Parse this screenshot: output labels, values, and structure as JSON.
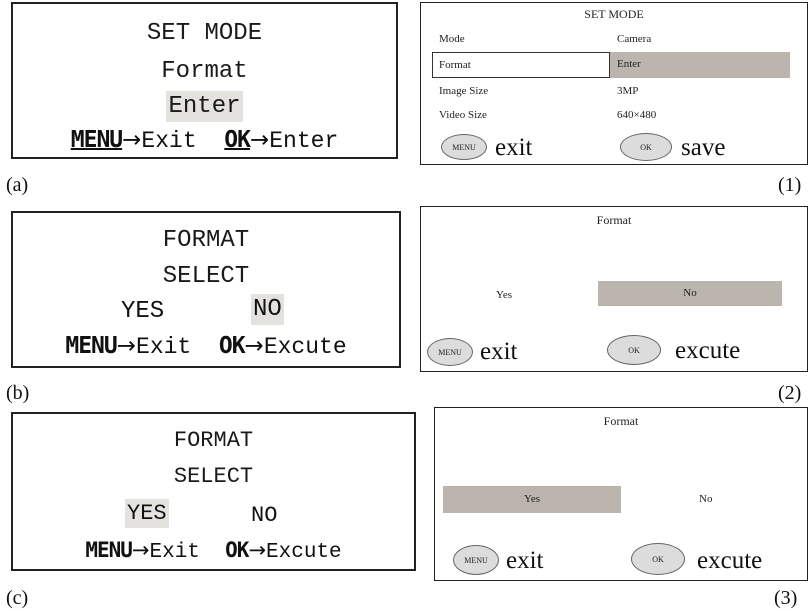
{
  "a": {
    "title": "SET MODE",
    "item": "Format",
    "selected": "Enter",
    "menu_key": "MENU",
    "menu_action": "Exit",
    "ok_key": "OK",
    "ok_action": "Enter",
    "arrow": "→",
    "label": "(a)"
  },
  "one": {
    "title": "SET MODE",
    "rows": [
      {
        "name": "Mode",
        "value": "Camera"
      },
      {
        "name": "Format",
        "value": "Enter"
      },
      {
        "name": "Image Size",
        "value": "3MP"
      },
      {
        "name": "Video Size",
        "value": "640×480"
      }
    ],
    "menu_icon": "MENU",
    "menu_text": "exit",
    "ok_icon": "OK",
    "ok_text": "save",
    "label": "(1)"
  },
  "b": {
    "title": "FORMAT",
    "subtitle": "SELECT",
    "yes": "YES",
    "no": "NO",
    "menu_key": "MENU",
    "menu_action": "Exit",
    "ok_key": "OK",
    "ok_action": "Excute",
    "arrow": "→",
    "label": "(b)"
  },
  "two": {
    "title": "Format",
    "yes": "Yes",
    "no": "No",
    "menu_icon": "MENU",
    "menu_text": "exit",
    "ok_icon": "OK",
    "ok_text": "excute",
    "label": "(2)"
  },
  "c": {
    "title": "FORMAT",
    "subtitle": "SELECT",
    "yes": "YES",
    "no": "NO",
    "menu_key": "MENU",
    "menu_action": "Exit",
    "ok_key": "OK",
    "ok_action": "Excute",
    "arrow": "→",
    "label": "(c)"
  },
  "three": {
    "title": "Format",
    "yes": "Yes",
    "no": "No",
    "menu_icon": "MENU",
    "menu_text": "exit",
    "ok_icon": "OK",
    "ok_text": "excute",
    "label": "(3)"
  },
  "colors": {
    "lcd_highlight": "#e4e2df",
    "screen_highlight": "#bcb5ad",
    "button_fill": "#dcdcdc"
  }
}
